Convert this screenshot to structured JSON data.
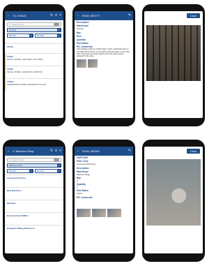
{
  "top_left": {
    "title": "Y:1 STACK",
    "search_placeholder": "Search items",
    "location_value": "STACK",
    "blank_a": "BLANK",
    "blank_b": "BLANK",
    "items": [
      {
        "a": "STACK",
        "b": ""
      },
      {
        "a": "TODAY",
        "b": "BATCH, MODEL, MAGNETIC 150 7685S"
      },
      {
        "a": "TODAY",
        "b": "IMAGE, MODEL, MAGNETIC A1542STE"
      },
      {
        "a": "TODAY",
        "b": "GENERATING MODEL MAGNETIC 07/14/22"
      }
    ]
  },
  "top_mid": {
    "title": "ROW, #00777",
    "f1_label": "Description",
    "f1_value": "",
    "f2_label": "Warehouse",
    "f2_value": "STACK",
    "f3_label": "Bay",
    "f3_value": "",
    "f4_label": "Row",
    "f4_value": "",
    "f5_label": "Quantity",
    "f5_value": "",
    "f6_label": "Part Status",
    "f6_value": "",
    "comments_label": "RS_Comments",
    "comments_value": "Auto stacking systems contains large motors, sealed and new on one side and corrosion on the bottom shelf and studs, on the other side. They have few studs related to the auto stack system assigned to the same."
  },
  "top_right": {
    "close_label": "Close"
  },
  "bottom_left": {
    "title": "Y: Machine Shop",
    "search_placeholder": "Search items",
    "location_value": "Machine Shop",
    "blank_a": "BLANK",
    "blank_b": "BLANK",
    "items": [
      {
        "a": "American Drill Press",
        "b": ""
      },
      {
        "a": "Mow Drill Press",
        "b": ""
      },
      {
        "a": "Bandsaw",
        "b": ""
      },
      {
        "a": "Bench Grinder 5005K4",
        "b": ""
      },
      {
        "a": "Bridgeport Milling Machine #1",
        "b": ""
      }
    ]
  },
  "bottom_mid": {
    "title": "ROW, #00001",
    "f1_label": "SUPPLIER",
    "f1_value": "",
    "f2_label": "Filter Code",
    "f2_value": "American Drill Press",
    "f3_label": "Description",
    "f3_value": "",
    "f4_label": "Warehouse",
    "f4_value": "Machine Shop",
    "f5_label": "Bay",
    "f5_value": "0",
    "f6_label": "Quantity",
    "f6_value": "1",
    "f7_label": "Part Status",
    "f7_value": "Active",
    "comments_label": "RS_Comments"
  },
  "bottom_right": {
    "close_label": "Close"
  },
  "colors": {
    "header": "#1f4e8c",
    "accent_yellow": "#f2c12e",
    "phone_frame": "#111111"
  },
  "icons": [
    "back-arrow-icon",
    "refresh-icon",
    "menu-icon",
    "add-icon",
    "edit-icon",
    "search-icon",
    "chevron-right-icon",
    "chevron-down-icon"
  ]
}
